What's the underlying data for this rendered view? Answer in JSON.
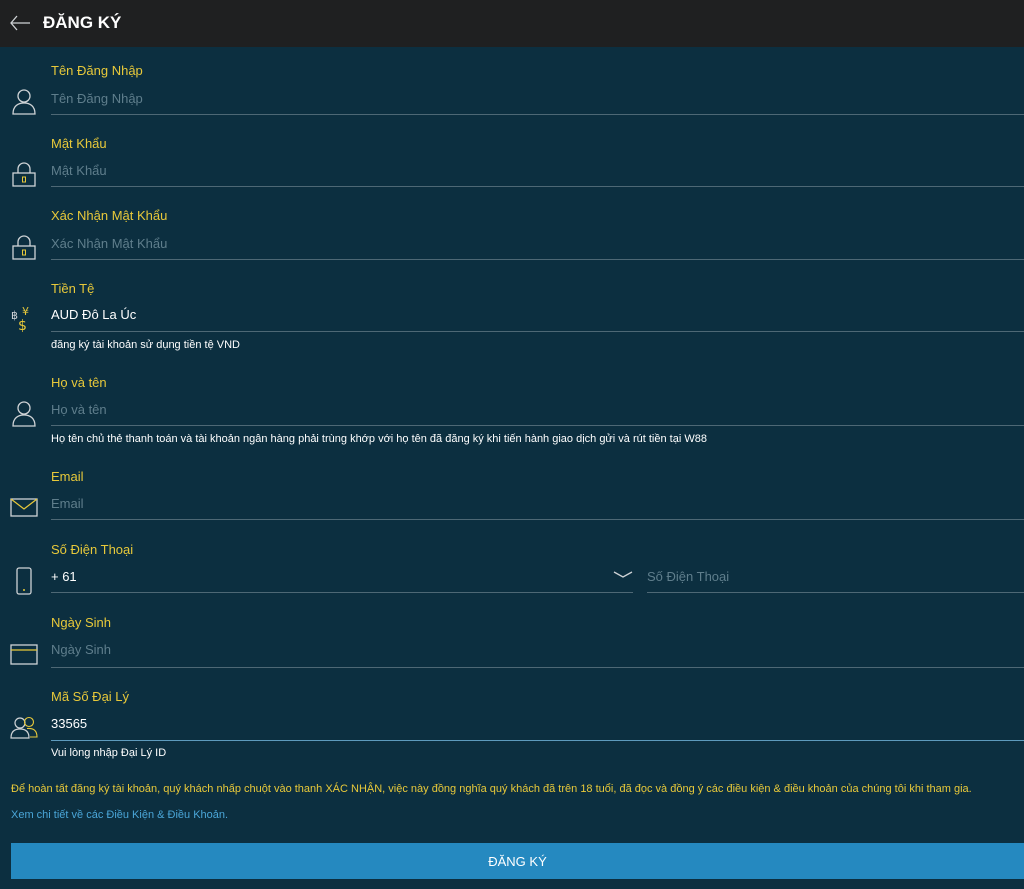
{
  "header": {
    "title": "ĐĂNG KÝ"
  },
  "fields": {
    "username": {
      "label": "Tên Đăng Nhập",
      "placeholder": "Tên Đăng Nhập"
    },
    "password": {
      "label": "Mật Khẩu",
      "placeholder": "Mật Khẩu"
    },
    "confirm_password": {
      "label": "Xác Nhận Mật Khẩu",
      "placeholder": "Xác Nhận Mật Khẩu"
    },
    "currency": {
      "label": "Tiền Tệ",
      "value": "AUD Đô La Úc",
      "hint": "đăng ký tài khoản sử dụng tiền tệ VND"
    },
    "full_name": {
      "label": "Họ và tên",
      "placeholder": "Họ và tên",
      "hint": "Họ tên chủ thẻ thanh toán và tài khoản ngân hàng phải trùng khớp với họ tên đã đăng ký khi tiến hành giao dịch gửi và rút tiền tại W88"
    },
    "email": {
      "label": "Email",
      "placeholder": "Email"
    },
    "phone": {
      "label": "Số Điện Thoại",
      "country_code": "+ 61",
      "placeholder": "Số Điện Thoại"
    },
    "birthday": {
      "label": "Ngày Sinh",
      "placeholder": "Ngày Sinh"
    },
    "agent_code": {
      "label": "Mã Số Đại Lý",
      "value": "33565",
      "hint": "Vui lòng nhập Đại Lý ID"
    }
  },
  "terms": {
    "text": "Để hoàn tất đăng ký tài khoản, quý khách nhấp chuột vào thanh XÁC NHẬN, việc này đồng nghĩa quý khách đã trên 18 tuổi, đã đọc và đồng ý các điều kiện & điều khoản của chúng tôi khi tham gia.",
    "link": "Xem chi tiết về các Điều Kiện & Điều Khoản."
  },
  "submit": {
    "label": "ĐĂNG KÝ"
  },
  "colors": {
    "background": "#0c2f40",
    "header": "#1f2021",
    "label": "#e8c93a",
    "button": "#2589c0",
    "link": "#4aa6d8"
  },
  "icons": [
    "arrow-left-icon",
    "user-icon",
    "lock-icon",
    "currency-icon",
    "envelope-icon",
    "phone-icon",
    "calendar-icon",
    "users-icon",
    "chevron-down-icon"
  ]
}
